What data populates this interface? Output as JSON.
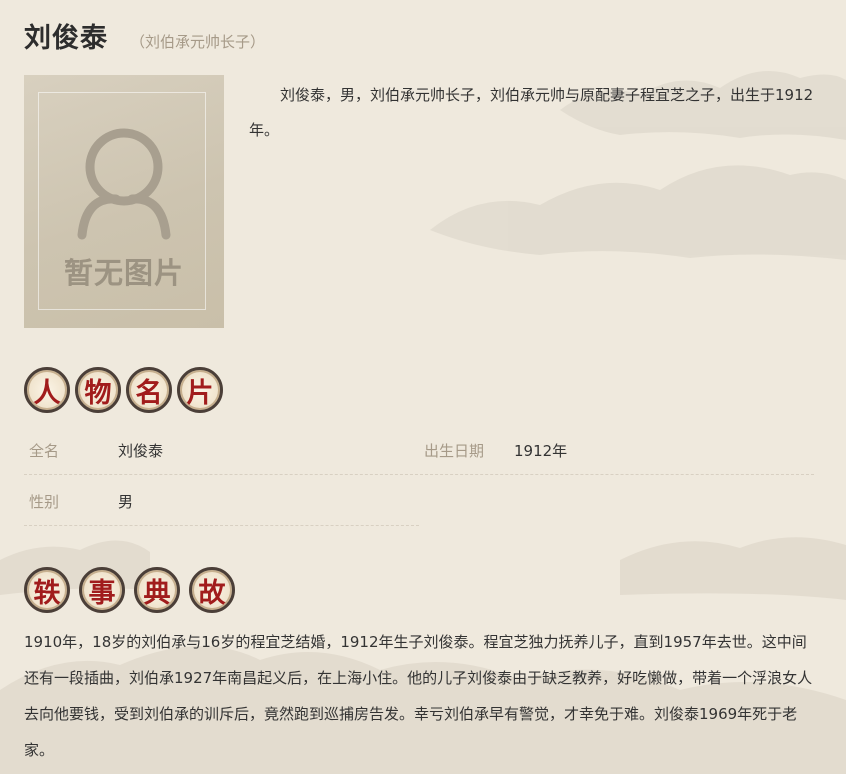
{
  "title": {
    "name": "刘俊泰",
    "subtitle": "（刘伯承元帅长子）"
  },
  "photo": {
    "placeholder_text": "暂无图片",
    "icon": "person-silhouette-icon"
  },
  "intro": "刘俊泰，男，刘伯承元帅长子，刘伯承元帅与原配妻子程宜芝之子，出生于1912年。",
  "sections": {
    "profile_heading": [
      "人",
      "物",
      "名",
      "片"
    ],
    "story_heading": [
      "轶",
      "事",
      "典",
      "故"
    ]
  },
  "profile": {
    "full_name_label": "全名",
    "full_name_value": "刘俊泰",
    "birth_label": "出生日期",
    "birth_value": "1912年",
    "gender_label": "性别",
    "gender_value": "男"
  },
  "story": "1910年，18岁的刘伯承与16岁的程宜芝结婚，1912年生子刘俊泰。程宜芝独力抚养儿子，直到1957年去世。这中间还有一段插曲，刘伯承1927年南昌起义后，在上海小住。他的儿子刘俊泰由于缺乏教养，好吃懒做，带着一个浮浪女人去向他要钱，受到刘伯承的训斥后，竟然跑到巡捕房告发。幸亏刘伯承早有警觉，才幸免于难。刘俊泰1969年死于老家。",
  "colors": {
    "background": "#efe9dd",
    "seal_text": "#a11c1c",
    "label": "#a69a88"
  }
}
